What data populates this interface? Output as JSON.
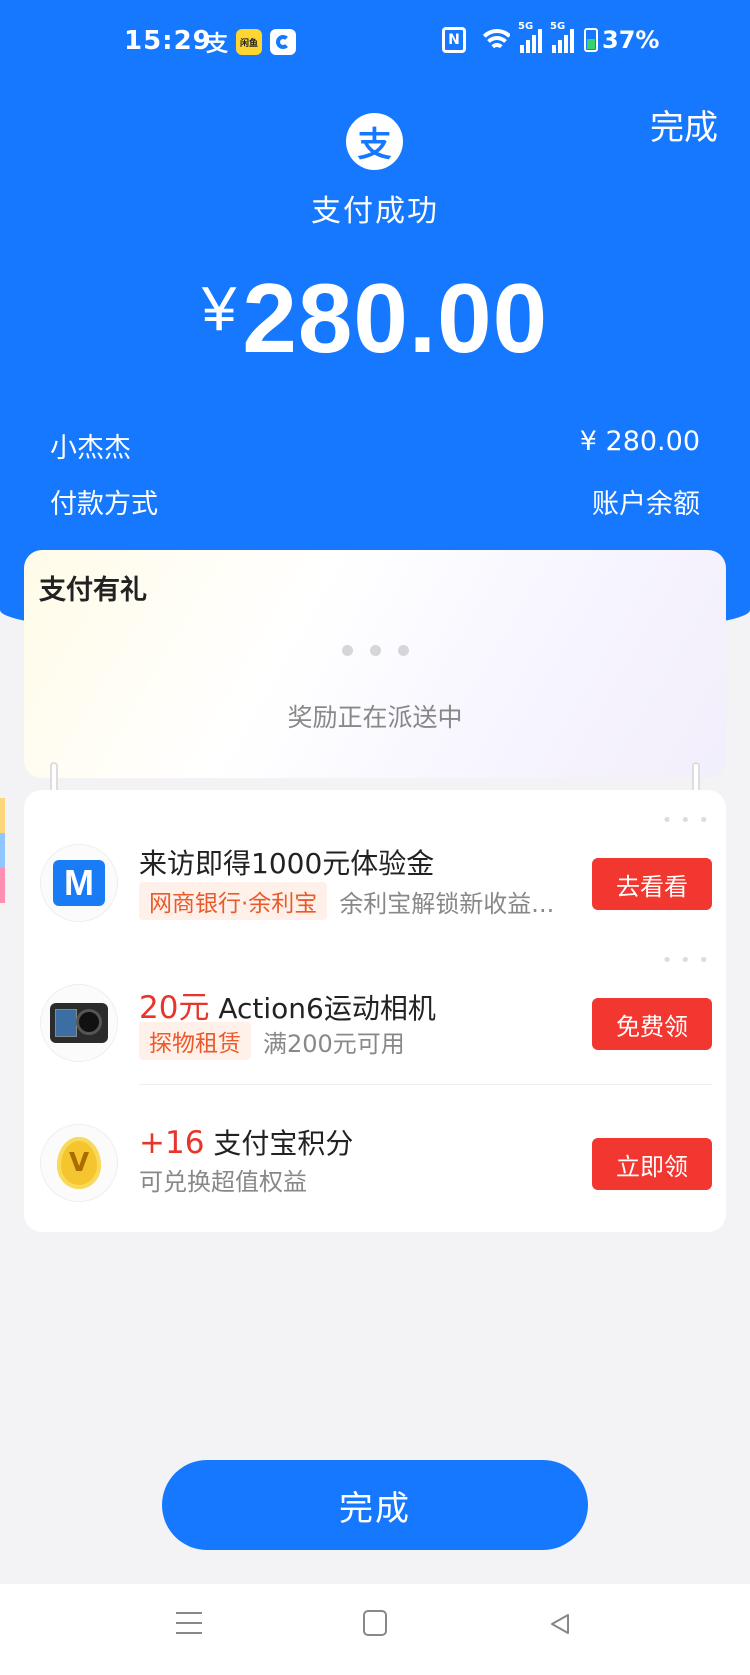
{
  "status_bar": {
    "time": "15:29",
    "alipay_glyph": "支",
    "yellow_app_label": "闲鱼",
    "network_label": "5G",
    "battery": "37%"
  },
  "header": {
    "done_label": "完成",
    "logo_glyph": "支",
    "title": "支付成功",
    "currency": "¥",
    "amount": "280.00",
    "payee_label": "小杰杰",
    "payee_amount": "¥ 280.00",
    "method_label": "付款方式",
    "method_value": "账户余额"
  },
  "reward_card": {
    "title": "支付有礼",
    "message": "奖励正在派送中"
  },
  "offers": [
    {
      "icon": "mybank-m-icon",
      "title": "来访即得1000元体验金",
      "tag": "网商银行·余利宝",
      "desc": "余利宝解锁新收益...",
      "button": "去看看"
    },
    {
      "icon": "action-camera-icon",
      "highlight": "20元",
      "title": " Action6运动相机",
      "tag": "探物租赁",
      "desc": "满200元可用",
      "button": "免费领"
    },
    {
      "icon": "points-coin-icon",
      "highlight": "+16",
      "title": " 支付宝积分",
      "desc": "可兑换超值权益",
      "button": "立即领"
    }
  ],
  "bottom": {
    "done_label": "完成"
  },
  "colors": {
    "brand_blue": "#1678ff",
    "action_red": "#f1372f",
    "tag_orange": "#ea5a2b"
  }
}
